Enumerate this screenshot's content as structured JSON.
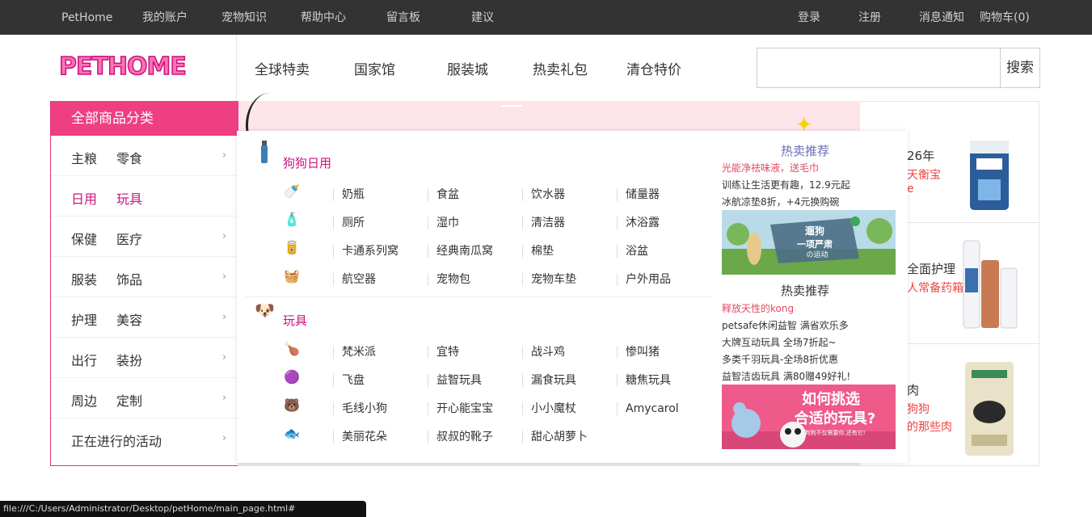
{
  "topbar": {
    "links": [
      "PetHome",
      "我的账户",
      "宠物知识",
      "帮助中心",
      "留言板",
      "建议"
    ],
    "right": [
      "登录",
      "注册",
      "消息通知",
      "购物车(0)"
    ]
  },
  "logo": {
    "text": "PETHOME"
  },
  "mainnav": [
    "全球特卖",
    "国家馆",
    "服装城",
    "热卖礼包",
    "清仓特价"
  ],
  "search": {
    "placeholder": "",
    "button": "搜索"
  },
  "sidebar": {
    "title": "全部商品分类",
    "rows": [
      {
        "l1": "主粮",
        "l2": "零食"
      },
      {
        "l1": "日用",
        "l2": "玩具"
      },
      {
        "l1": "保健",
        "l2": "医疗"
      },
      {
        "l1": "服装",
        "l2": "饰品"
      },
      {
        "l1": "护理",
        "l2": "美容"
      },
      {
        "l1": "出行",
        "l2": "装扮"
      },
      {
        "l1": "周边",
        "l2": "定制"
      },
      {
        "l1": "正在进行的活动",
        "l2": ""
      }
    ],
    "arrow": "›"
  },
  "panel": {
    "cat1": {
      "title": "狗狗日用",
      "rows": [
        [
          "奶瓶",
          "食盆",
          "饮水器",
          "储量器"
        ],
        [
          "厕所",
          "湿巾",
          "清洁器",
          "沐浴露"
        ],
        [
          "卡通系列窝",
          "经典南瓜窝",
          "棉垫",
          "浴盆"
        ],
        [
          "航空器",
          "宠物包",
          "宠物车垫",
          "户外用品"
        ]
      ]
    },
    "cat2": {
      "title": "玩具",
      "rows": [
        [
          "梵米派",
          "宜特",
          "战斗鸡",
          "惨叫猪"
        ],
        [
          "飞盘",
          "益智玩具",
          "漏食玩具",
          "糖焦玩具"
        ],
        [
          "毛线小狗",
          "开心能宝宝",
          "小小魔杖",
          "Amycarol"
        ],
        [
          "美丽花朵",
          "叔叔的靴子",
          "甜心胡萝卜",
          ""
        ]
      ]
    },
    "hot1": {
      "title": "热卖推荐",
      "promo": "光能净祛味液，送毛巾",
      "lines": [
        "训练让生活更有趣，12.9元起",
        "冰航凉垫8折，+4元换购碗"
      ],
      "banner_line1": "遛狗",
      "banner_line2": "一项严肃",
      "banner_line3": "の运动"
    },
    "hot2": {
      "title": "热卖推荐",
      "promo": "释放天性的kong",
      "lines": [
        "petsafe休闲益智 满省欢乐多",
        "大牌互动玩具 全场7折起~",
        "多类千羽玩具-全场8折优惠",
        "益智洁齿玩具 满80赠49好礼!"
      ],
      "banner_line1": "如何挑选",
      "banner_line2": "合适的玩具?",
      "banner_small": "狗狗不仅需要你,还有它!"
    }
  },
  "right_col": [
    {
      "t1": "26年",
      "t2": "天衡宝",
      "t3": "e"
    },
    {
      "t1": "全面护理",
      "t2": "人常备药箱",
      "t3": ""
    },
    {
      "t1": "肉",
      "t2": "狗狗",
      "t3": "的那些肉"
    }
  ],
  "statusbar": {
    "url": "file:///C:/Users/Administrator/Desktop/petHome/main_page.html#"
  },
  "colors": {
    "accent": "#ee3f82",
    "topbar": "#333333",
    "hot_title": "#6a6ab8"
  }
}
